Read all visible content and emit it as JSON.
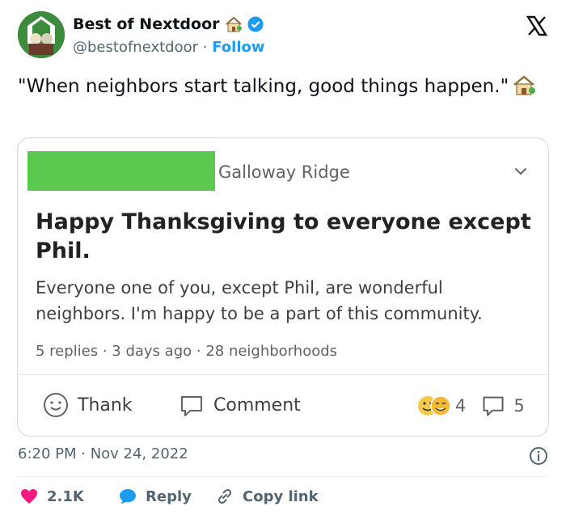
{
  "author": {
    "display_name": "Best of Nextdoor",
    "handle": "@bestofnextdoor",
    "separator": "·",
    "follow_label": "Follow"
  },
  "tweet": {
    "text": "\"When neighbors start talking, good things happen.\""
  },
  "card": {
    "group_name": "Galloway Ridge",
    "post_title": "Happy Thanksgiving to everyone except Phil.",
    "post_body": "Everyone one of you, except Phil, are wonderful neighbors. I'm happy to be a part of this community.",
    "meta": "5 replies · 3 days ago · 28 neighborhoods",
    "thank_label": "Thank",
    "comment_label": "Comment",
    "reaction_count": "4",
    "reply_count": "5"
  },
  "footer": {
    "timestamp": "6:20 PM · Nov 24, 2022",
    "likes": "2.1K",
    "reply_label": "Reply",
    "copy_link_label": "Copy link"
  },
  "colors": {
    "accent": "#1d9bf0",
    "like": "#f91880",
    "redacted_block": "#5bc94f"
  }
}
